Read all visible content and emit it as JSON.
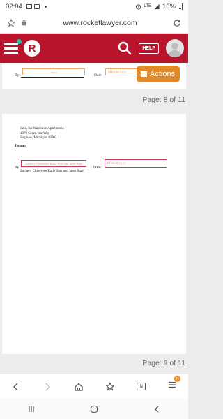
{
  "status_bar": {
    "time": "02:04",
    "network": "LTE",
    "battery": "16%"
  },
  "browser": {
    "url": "www.rocketlawyer.com",
    "tab_count": "N",
    "menu_badge": "N"
  },
  "header": {
    "logo_letter": "R",
    "help_label": "HELP"
  },
  "actions_button": {
    "label": "Actions"
  },
  "page1": {
    "by_label": "By:",
    "signature_placeholder": "Sara",
    "date_label": "Date:",
    "date_placeholder": "MM/dd/yyyy",
    "page_indicator": "Page: 8 of 11"
  },
  "page2": {
    "address_lines": [
      "Sara, for Waterside Apartments",
      "4070 Green Isle Way",
      "Saginaw, Michigan 48603"
    ],
    "tenant_label": "Tenant:",
    "by_label": "By:",
    "signature_placeholder": "Zachery Chinevere Katie Sian and Jalen Sian",
    "signer_names": "Zachery Chinevere Katie Sian and Jalen Sian",
    "date_label": "Date:",
    "date_placeholder": "MM/dd/yyyy",
    "page_indicator": "Page: 9 of 11"
  },
  "colors": {
    "brand_red": "#b8142c",
    "actions_orange": "#e08a2c",
    "field_orange": "#e8a865",
    "field_pink": "#cc3a5a"
  }
}
